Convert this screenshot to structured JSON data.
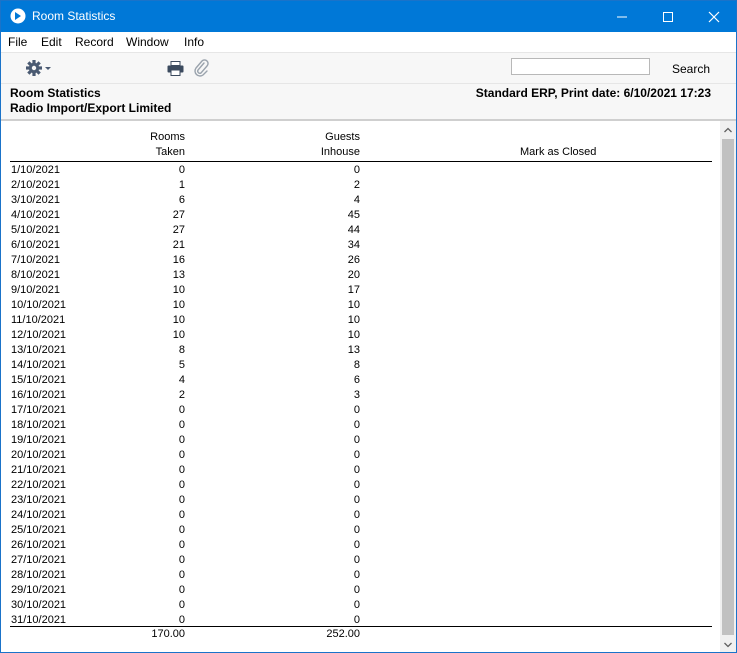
{
  "window": {
    "title": "Room Statistics"
  },
  "menu": [
    "File",
    "Edit",
    "Record",
    "Window",
    "Info"
  ],
  "toolbar": {
    "search_placeholder": "",
    "search_label": "Search"
  },
  "header": {
    "report_name": "Room Statistics",
    "company": "Radio Import/Export Limited",
    "print_info": "Standard ERP, Print date: 6/10/2021 17:23"
  },
  "columns": {
    "rooms_line1": "Rooms",
    "rooms_line2": "Taken",
    "guests_line1": "Guests",
    "guests_line2": "Inhouse",
    "mark_closed": "Mark as Closed"
  },
  "rows": [
    {
      "date": "1/10/2021",
      "rooms": "0",
      "guests": "0"
    },
    {
      "date": "2/10/2021",
      "rooms": "1",
      "guests": "2"
    },
    {
      "date": "3/10/2021",
      "rooms": "6",
      "guests": "4"
    },
    {
      "date": "4/10/2021",
      "rooms": "27",
      "guests": "45"
    },
    {
      "date": "5/10/2021",
      "rooms": "27",
      "guests": "44"
    },
    {
      "date": "6/10/2021",
      "rooms": "21",
      "guests": "34"
    },
    {
      "date": "7/10/2021",
      "rooms": "16",
      "guests": "26"
    },
    {
      "date": "8/10/2021",
      "rooms": "13",
      "guests": "20"
    },
    {
      "date": "9/10/2021",
      "rooms": "10",
      "guests": "17"
    },
    {
      "date": "10/10/2021",
      "rooms": "10",
      "guests": "10"
    },
    {
      "date": "11/10/2021",
      "rooms": "10",
      "guests": "10"
    },
    {
      "date": "12/10/2021",
      "rooms": "10",
      "guests": "10"
    },
    {
      "date": "13/10/2021",
      "rooms": "8",
      "guests": "13"
    },
    {
      "date": "14/10/2021",
      "rooms": "5",
      "guests": "8"
    },
    {
      "date": "15/10/2021",
      "rooms": "4",
      "guests": "6"
    },
    {
      "date": "16/10/2021",
      "rooms": "2",
      "guests": "3"
    },
    {
      "date": "17/10/2021",
      "rooms": "0",
      "guests": "0"
    },
    {
      "date": "18/10/2021",
      "rooms": "0",
      "guests": "0"
    },
    {
      "date": "19/10/2021",
      "rooms": "0",
      "guests": "0"
    },
    {
      "date": "20/10/2021",
      "rooms": "0",
      "guests": "0"
    },
    {
      "date": "21/10/2021",
      "rooms": "0",
      "guests": "0"
    },
    {
      "date": "22/10/2021",
      "rooms": "0",
      "guests": "0"
    },
    {
      "date": "23/10/2021",
      "rooms": "0",
      "guests": "0"
    },
    {
      "date": "24/10/2021",
      "rooms": "0",
      "guests": "0"
    },
    {
      "date": "25/10/2021",
      "rooms": "0",
      "guests": "0"
    },
    {
      "date": "26/10/2021",
      "rooms": "0",
      "guests": "0"
    },
    {
      "date": "27/10/2021",
      "rooms": "0",
      "guests": "0"
    },
    {
      "date": "28/10/2021",
      "rooms": "0",
      "guests": "0"
    },
    {
      "date": "29/10/2021",
      "rooms": "0",
      "guests": "0"
    },
    {
      "date": "30/10/2021",
      "rooms": "0",
      "guests": "0"
    },
    {
      "date": "31/10/2021",
      "rooms": "0",
      "guests": "0"
    }
  ],
  "totals": {
    "rooms": "170.00",
    "guests": "252.00"
  },
  "colors": {
    "titlebar": "#0078d7",
    "toolbar_bg": "#f7f7f7",
    "scroll_thumb": "#c1c1c1"
  },
  "icons": [
    "app-icon",
    "minimize-icon",
    "maximize-icon",
    "close-icon",
    "gear-icon",
    "dropdown-arrow-icon",
    "print-icon",
    "paperclip-icon",
    "scroll-up-icon",
    "scroll-down-icon"
  ]
}
